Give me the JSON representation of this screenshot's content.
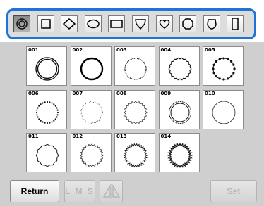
{
  "tabs": [
    {
      "icon": "concentric-circle-icon",
      "selected": true
    },
    {
      "icon": "square-icon",
      "selected": false
    },
    {
      "icon": "diamond-icon",
      "selected": false
    },
    {
      "icon": "oval-icon",
      "selected": false
    },
    {
      "icon": "rectangle-icon",
      "selected": false
    },
    {
      "icon": "shield-icon",
      "selected": false
    },
    {
      "icon": "heart-icon",
      "selected": false
    },
    {
      "icon": "octagon-icon",
      "selected": false
    },
    {
      "icon": "rounded-shield-icon",
      "selected": false
    },
    {
      "icon": "tall-rectangle-icon",
      "selected": false
    }
  ],
  "patterns": [
    {
      "number": "001",
      "style": "double"
    },
    {
      "number": "002",
      "style": "thick"
    },
    {
      "number": "003",
      "style": "dotted-fine"
    },
    {
      "number": "004",
      "style": "bumpy"
    },
    {
      "number": "005",
      "style": "beaded"
    },
    {
      "number": "006",
      "style": "beaded-small"
    },
    {
      "number": "007",
      "style": "dashed-light"
    },
    {
      "number": "008",
      "style": "zigzag"
    },
    {
      "number": "009",
      "style": "double-stitch"
    },
    {
      "number": "010",
      "style": "thin"
    },
    {
      "number": "011",
      "style": "scalloped"
    },
    {
      "number": "012",
      "style": "fringe"
    },
    {
      "number": "013",
      "style": "fringe-dense"
    },
    {
      "number": "014",
      "style": "fringe-heavy"
    }
  ],
  "buttons": {
    "return_label": "Return",
    "lms_label": "L M S",
    "mirror_icon": "mirror-flip-icon",
    "set_label": "Set"
  },
  "colors": {
    "tab_frame": "#1e73d8",
    "background": "#cfcfcf"
  }
}
